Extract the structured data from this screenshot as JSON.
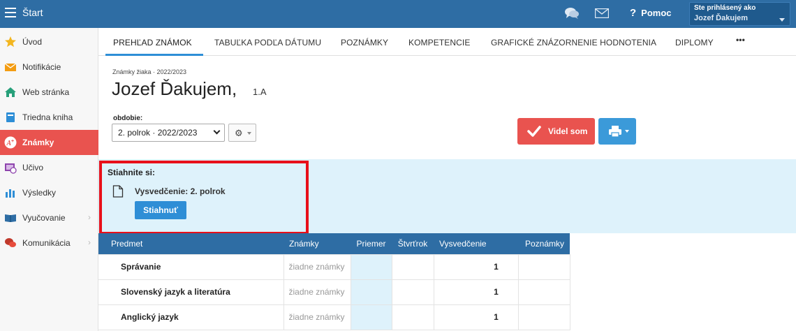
{
  "topbar": {
    "title": "Štart",
    "help": "Pomoc",
    "user_label": "Ste prihlásený ako",
    "user_name": "Jozef Ďakujem"
  },
  "sidebar": {
    "items": [
      {
        "label": "Úvod",
        "icon": "star-icon"
      },
      {
        "label": "Notifikácie",
        "icon": "envelope-icon"
      },
      {
        "label": "Web stránka",
        "icon": "home-icon"
      },
      {
        "label": "Triedna kniha",
        "icon": "book-icon"
      },
      {
        "label": "Známky",
        "icon": "grade-icon",
        "active": true
      },
      {
        "label": "Učivo",
        "icon": "curriculum-icon"
      },
      {
        "label": "Výsledky",
        "icon": "bar-chart-icon"
      },
      {
        "label": "Vyučovanie",
        "icon": "open-book-icon",
        "chevron": true
      },
      {
        "label": "Komunikácia",
        "icon": "chat-bubbles-icon",
        "chevron": true
      }
    ]
  },
  "tabs": [
    "PREHĽAD ZNÁMOK",
    "TABUĽKA PODĽA DÁTUMU",
    "POZNÁMKY",
    "KOMPETENCIE",
    "GRAFICKÉ ZNÁZORNENIE HODNOTENIA",
    "DIPLOMY",
    "•••"
  ],
  "header": {
    "subtitle": "Známky žiaka · 2022/2023",
    "student_name": "Jozef Ďakujem,",
    "class": "1.A",
    "period_label": "obdobie:",
    "period_value": "2. polrok · 2022/2023"
  },
  "actions": {
    "seen": "Videl som"
  },
  "download": {
    "title": "Stiahnite si:",
    "file": "Vysvedčenie: 2. polrok",
    "button": "Stiahnuť"
  },
  "table": {
    "headers": [
      "Predmet",
      "Známky",
      "Priemer",
      "Štvrťrok",
      "Vysvedčenie",
      "Poznámky"
    ],
    "rows": [
      {
        "subject": "Správanie",
        "grades": "žiadne známky",
        "average": "",
        "quarter": "",
        "final": "1",
        "notes": ""
      },
      {
        "subject": "Slovenský jazyk a literatúra",
        "grades": "žiadne známky",
        "average": "",
        "quarter": "",
        "final": "1",
        "notes": ""
      },
      {
        "subject": "Anglický jazyk",
        "grades": "žiadne známky",
        "average": "",
        "quarter": "",
        "final": "1",
        "notes": ""
      }
    ]
  },
  "colors": {
    "topbar": "#2e6da4",
    "accent": "#e9534f",
    "primary": "#3b9ad9",
    "highlight_border": "#e8101a",
    "download_bg": "#def2fb"
  }
}
